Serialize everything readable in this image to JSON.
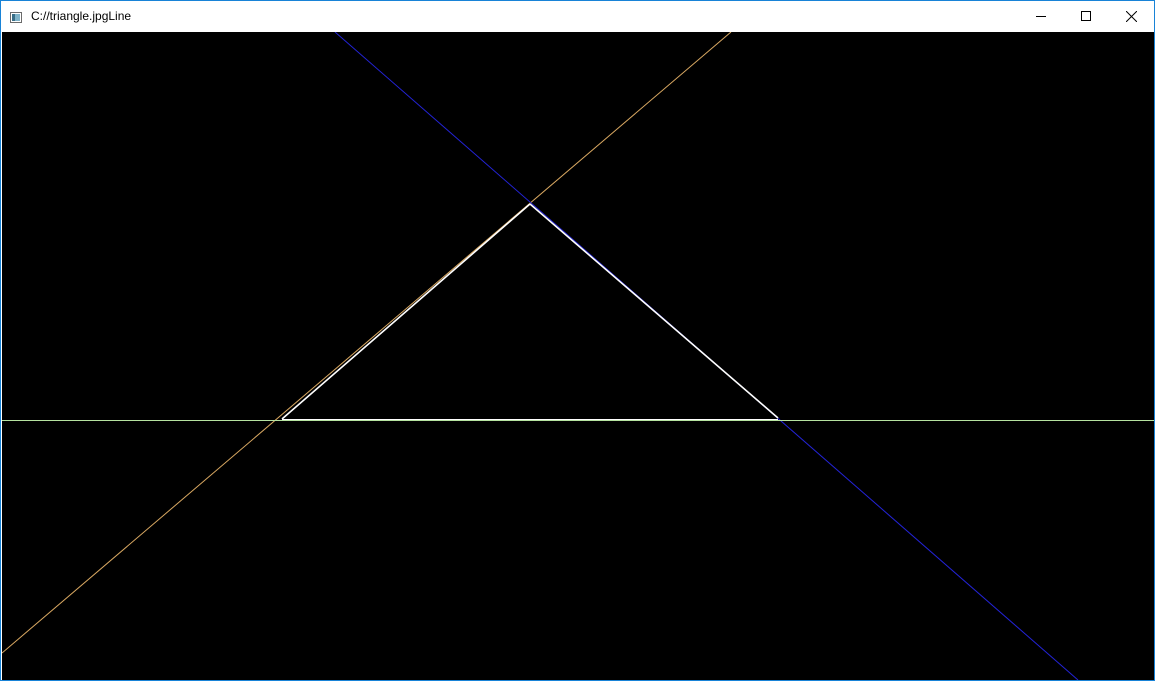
{
  "window": {
    "title": "C://triangle.jpgLine",
    "icons": {
      "app": "app-window-icon",
      "minimize": "minimize-icon",
      "maximize": "maximize-icon",
      "close": "close-icon"
    }
  },
  "colors": {
    "background": "#000000",
    "border": "#1883d7",
    "line_left": "#d9a862",
    "line_right": "#2323d6",
    "line_horizontal": "#b6e3a1",
    "triangle_edge": "#ffffff"
  }
}
